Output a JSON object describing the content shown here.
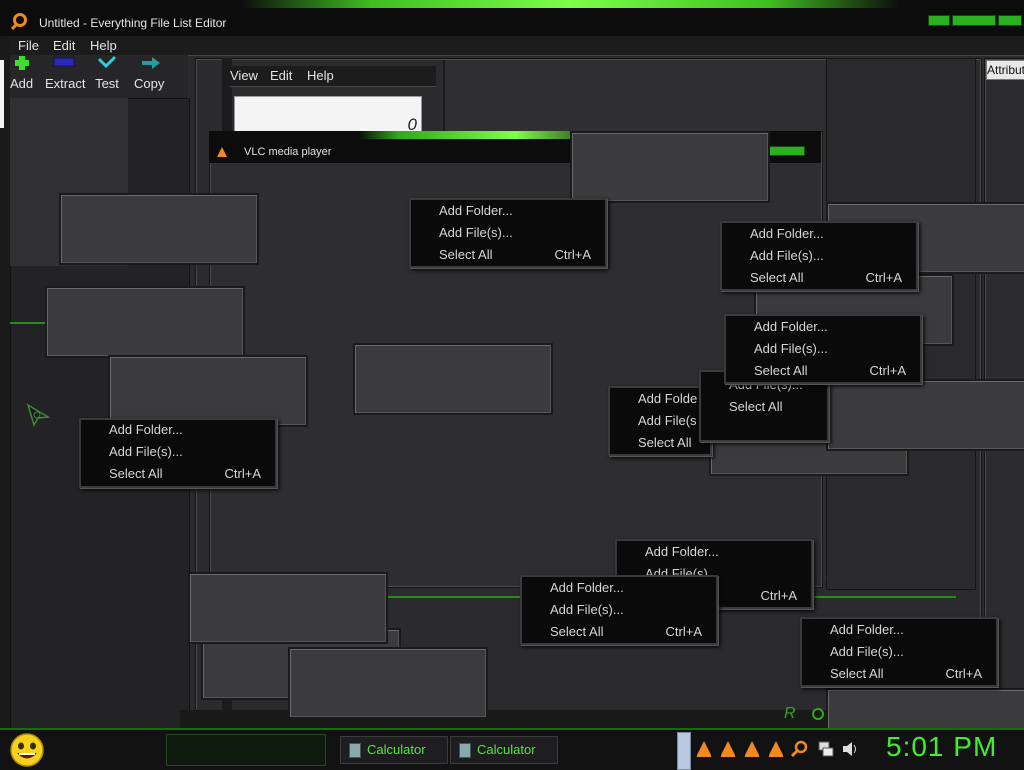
{
  "main_window": {
    "title": "Untitled - Everything File List Editor",
    "menu": [
      "File",
      "Edit",
      "Help"
    ],
    "toolbar": [
      {
        "label": "Add",
        "icon": "plus-icon"
      },
      {
        "label": "Extract",
        "icon": "extract-icon"
      },
      {
        "label": "Test",
        "icon": "check-icon"
      },
      {
        "label": "Copy",
        "icon": "arrow-right-icon"
      }
    ],
    "column_header": "Attribut"
  },
  "inner_window": {
    "menu": [
      "View",
      "Edit",
      "Help"
    ],
    "value": "0"
  },
  "vlc_window": {
    "title": "VLC media player"
  },
  "context_menu": {
    "add_folder": "Add Folder...",
    "add_files": "Add File(s)...",
    "select_all": "Select All",
    "select_all_shortcut": "Ctrl+A",
    "add_folder_clipped": "Add Folde",
    "add_files_clipped": "Add File(s"
  },
  "taskbar": {
    "buttons": [
      "Calculator",
      "Calculator"
    ],
    "clock": "5:01 PM"
  },
  "colors": {
    "accent_green": "#3ef02a",
    "vlc_orange": "#f08a1c"
  }
}
